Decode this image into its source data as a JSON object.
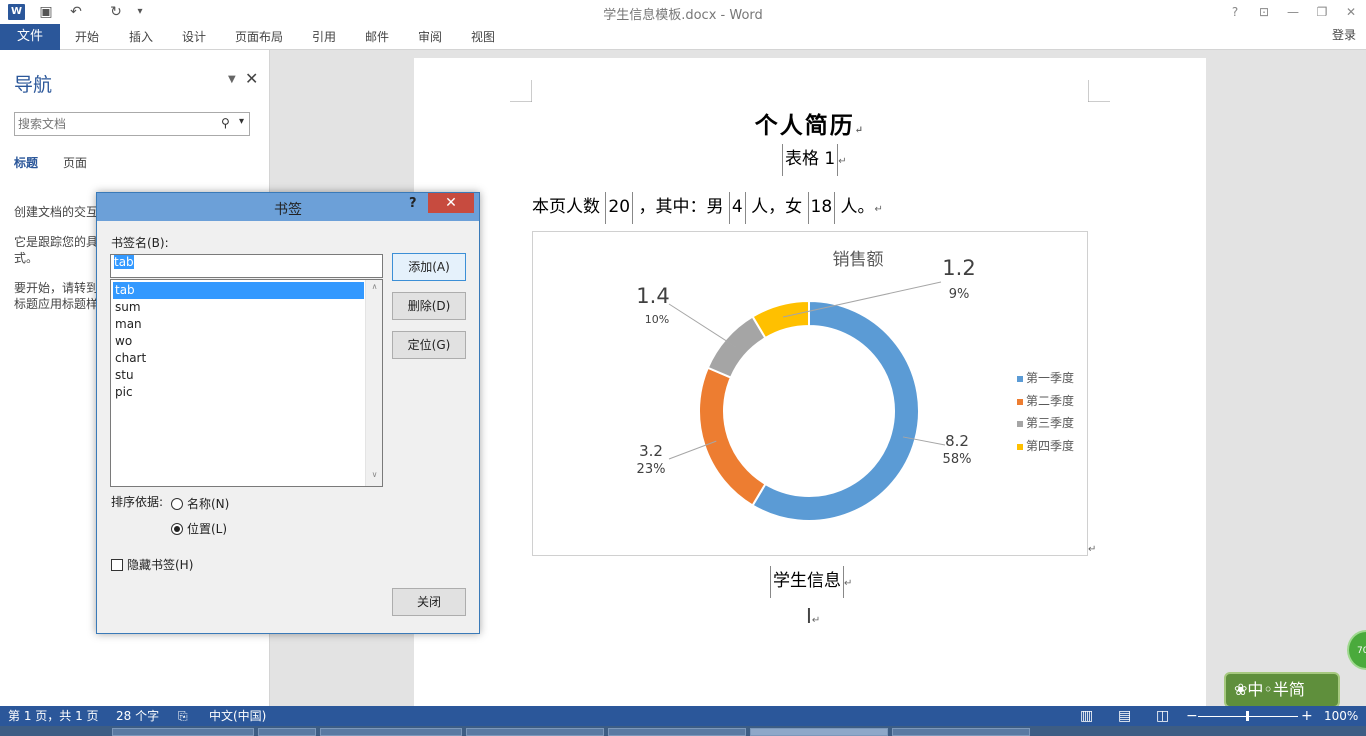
{
  "window": {
    "title": "学生信息模板.docx - Word",
    "logo": "W",
    "undo_icon": "↶",
    "redo_icon": "↻",
    "save_icon": "▣",
    "customize_icon": "▾",
    "help": "?",
    "ribbon_display": "⊡",
    "minimize": "—",
    "restore": "❐",
    "close": "✕"
  },
  "ribbon": {
    "file_tab": "文件",
    "tabs": [
      "开始",
      "插入",
      "设计",
      "页面布局",
      "引用",
      "邮件",
      "审阅",
      "视图"
    ],
    "signin": "登录"
  },
  "nav": {
    "title": "导航",
    "menu_icon": "▼",
    "close_icon": "✕",
    "search_placeholder": "搜索文档",
    "search_icon": "⚲",
    "dropdown_icon": "▾",
    "tabs": [
      "标题",
      "页面"
    ],
    "text1": "创建文档的交互",
    "text2a": "它是跟踪您的具",
    "text2b": "式。",
    "text3a": "要开始，请转到",
    "text3b": "标题应用标题样"
  },
  "document": {
    "heading": "个人简历",
    "para1_bookmark": "表格 1",
    "para2": {
      "prefix": "本页人数 ",
      "total": "20",
      "mid1": " ，其中：男 ",
      "male": "4",
      "mid2": " 人，女 ",
      "female": "18",
      "suffix": " 人。"
    },
    "para3_bookmark": "学生信息",
    "para_mark": "↵"
  },
  "chart_data": {
    "type": "donut",
    "title": "销售额",
    "categories": [
      "第一季度",
      "第二季度",
      "第三季度",
      "第四季度"
    ],
    "values": [
      8.2,
      3.2,
      1.4,
      1.2
    ],
    "percent_labels": [
      "58%",
      "23%",
      "10%",
      "9%"
    ],
    "value_labels": [
      "8.2",
      "3.2",
      "1.4",
      "1.2"
    ],
    "colors": [
      "#5b9bd5",
      "#ed7d31",
      "#a5a5a5",
      "#ffc000"
    ],
    "legend_position": "right"
  },
  "dialog": {
    "title": "书签",
    "help": "?",
    "close": "✕",
    "name_label": "书签名(B):",
    "name_value": "tab",
    "items": [
      "tab",
      "sum",
      "man",
      "wo",
      "chart",
      "stu",
      "pic"
    ],
    "selected": "tab",
    "scroll_up": "∧",
    "scroll_down": "∨",
    "buttons": {
      "add": "添加(A)",
      "delete": "删除(D)",
      "goto": "定位(G)",
      "close": "关闭"
    },
    "sort_label": "排序依据:",
    "sort_name": "名称(N)",
    "sort_position": "位置(L)",
    "sort_selected": "position",
    "hide_label": "隐藏书签(H)"
  },
  "status": {
    "page": "第 1 页，共 1 页",
    "words": "28 个字",
    "proof_icon": "⎘",
    "language": "中文(中国)",
    "view_read": "▥",
    "view_print": "▤",
    "view_web": "◫",
    "zoom_out": "−",
    "zoom_in": "+",
    "zoom": "100%"
  },
  "ime": {
    "text": "❀中◦半简",
    "badge": "70"
  }
}
